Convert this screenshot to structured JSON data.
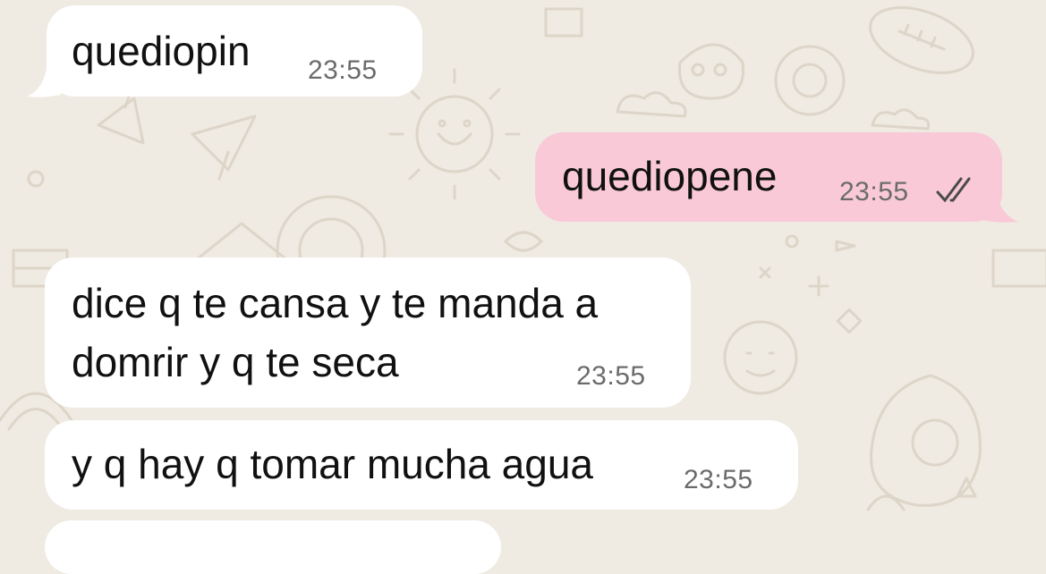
{
  "chat": {
    "messages": [
      {
        "direction": "incoming",
        "text": "quediopin",
        "time": "23:55"
      },
      {
        "direction": "outgoing",
        "text": "quediopene",
        "time": "23:55",
        "status": "double-check"
      },
      {
        "direction": "incoming",
        "lines": [
          "dice q te cansa y te manda a",
          "domrir y q te seca"
        ],
        "time": "23:55"
      },
      {
        "direction": "incoming",
        "text": "y q hay q tomar mucha agua",
        "time": "23:55"
      }
    ]
  },
  "colors": {
    "wallpaper": "#efeae2",
    "incoming_bubble": "#ffffff",
    "outgoing_bubble": "#f9c9d7",
    "timestamp": "#6b6b6b"
  }
}
